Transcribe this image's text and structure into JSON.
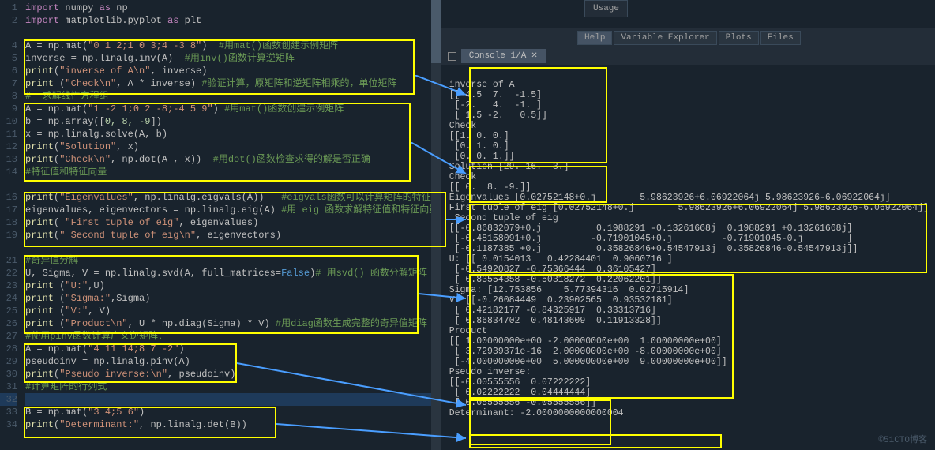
{
  "top": {
    "usage": "Usage"
  },
  "tabs": {
    "help": "Help",
    "varexp": "Variable Explorer",
    "plots": "Plots",
    "files": "Files"
  },
  "console": {
    "tab": "Console 1/A"
  },
  "gutter": [
    "1",
    "2",
    "",
    "4",
    "5",
    "6",
    "7",
    "8",
    "9",
    "10",
    "11",
    "12",
    "13",
    "14",
    "",
    "16",
    "17",
    "18",
    "19",
    "",
    "21",
    "22",
    "23",
    "24",
    "25",
    "26",
    "27",
    "28",
    "29",
    "30",
    "31",
    "32",
    "33",
    "34"
  ],
  "code": {
    "l1a": "import",
    "l1b": " numpy ",
    "l1c": "as",
    "l1d": " np",
    "l2a": "import",
    "l2b": " matplotlib.pyplot ",
    "l2c": "as",
    "l2d": " plt",
    "l4": "A = np.mat(",
    "l4s": "\"0 1 2;1 0 3;4 -3 8\"",
    "l4e": ")  ",
    "l4c": "#用mat()函数创建示例矩阵",
    "l5": "inverse = np.linalg.inv(A)  ",
    "l5c": "#用inv()函数计算逆矩阵",
    "l6a": "print",
    "l6b": "(",
    "l6s": "\"inverse of A\\n\"",
    "l6c": ", inverse)",
    "l7a": "print ",
    "l7b": "(",
    "l7s": "\"Check\\n\"",
    "l7c": ", A * inverse) ",
    "l7d": "#验证计算，原矩阵和逆矩阵相乘的，单位矩阵",
    "l8": "#  求解线性方程组",
    "l9": "A = np.mat(",
    "l9s": "\"1 -2 1;0 2 -8;-4 5 9\"",
    "l9e": ") ",
    "l9c": "#用mat()函数创建示例矩阵",
    "l10": "b = np.array([",
    "l10n": "0, 8, -9",
    "l10e": "])",
    "l11": "x = np.linalg.solve(A, b)",
    "l12a": "print",
    "l12b": "(",
    "l12s": "\"Solution\"",
    "l12c": ", x)",
    "l13a": "print",
    "l13b": "(",
    "l13s": "\"Check\\n\"",
    "l13c": ", np.dot(A , x))  ",
    "l13d": "#用dot()函数检查求得的解是否正确",
    "l14": "#特征值和特征向量",
    "l16a": "print",
    "l16b": "(",
    "l16s": "\"Eigenvalues\"",
    "l16c": ", np.linalg.eigvals(A))   ",
    "l16d": "#eigvals函数可以计算矩阵的特征值",
    "l17": "eigenvalues, eigenvectors = np.linalg.eig(A) ",
    "l17c": "#用 eig 函数求解特征值和特征向量",
    "l18a": "print",
    "l18b": "( ",
    "l18s": "\"First tuple of eig\"",
    "l18c": ", eigenvalues)",
    "l19a": "print",
    "l19b": "(",
    "l19s": "\" Second tuple of eig\\n\"",
    "l19c": ", eigenvectors)",
    "l21": "#奇异值分解",
    "l22": "U, Sigma, V = np.linalg.svd(A, full_matrices=",
    "l22f": "False",
    "l22e": ")",
    "l22c": "# 用svd() 函数分解矩阵",
    "l23a": "print ",
    "l23b": "(",
    "l23s": "\"U:\"",
    "l23c": ",U)",
    "l24a": "print ",
    "l24b": "(",
    "l24s": "\"Sigma:\"",
    "l24c": ",Sigma)",
    "l25a": "print ",
    "l25b": "(",
    "l25s": "\"V:\"",
    "l25c": ", V)",
    "l26a": "print ",
    "l26b": "(",
    "l26s": "\"Product\\n\"",
    "l26c": ", U * np.diag(Sigma) * V) ",
    "l26d": "#用diag函数生成完整的奇异值矩阵",
    "l27": "#使用pinv函数计算广义逆矩阵：",
    "l28": "A = np.mat(",
    "l28s": "\"4 11 14;8 7 -2\"",
    "l28e": ")",
    "l29": "pseudoinv = np.linalg.pinv(A)",
    "l30a": "print",
    "l30b": "(",
    "l30s": "\"Pseudo inverse:\\n\"",
    "l30c": ", pseudoinv)",
    "l31": "#计算矩阵的行列式",
    "l33": "B = np.mat(",
    "l33s": "\"3 4;5 6\"",
    "l33e": ")",
    "l34a": "print",
    "l34b": "(",
    "l34s": "\"Determinant:\"",
    "l34c": ", np.linalg.det(B))"
  },
  "out": {
    "o1": "inverse of A",
    "o2": "[[-4.5  7.  -1.5]",
    "o3": " [-2.   4.  -1. ]",
    "o4": " [ 1.5 -2.   0.5]]",
    "o5": "Check",
    "o6": "[[1. 0. 0.]",
    "o7": " [0. 1. 0.]",
    "o8": " [0. 0. 1.]]",
    "o9": "Solution [29. 16.  3.]",
    "o10": "Check",
    "o11": "[[ 0.  8. -9.]]",
    "o12": "Eigenvalues [0.02752148+0.j        5.98623926+6.06922064j 5.98623926-6.06922064j]",
    "o13": "First tuple of eig [0.02752148+0.j        5.98623926+6.06922064j 5.98623926-6.06922064j]",
    "o14": " Second tuple of eig",
    "o15": "[[-0.86832079+0.j          0.1988291 -0.13261668j  0.1988291 +0.13261668j]",
    "o16": " [-0.48158091+0.j         -0.71901045+0.j         -0.71901045-0.j        ]",
    "o17": " [-0.1187385 +0.j          0.35826846+0.54547913j  0.35826846-0.54547913j]]",
    "o18": "U: [[ 0.0154013   0.42284401  0.9060716 ]",
    "o19": " [-0.54920827 -0.75366444  0.36105427]",
    "o20": " [ 0.83554358 -0.50318272  0.22062201]]",
    "o21": "Sigma: [12.753856    5.77394316  0.02715914]",
    "o22": "V: [[-0.26084449  0.23902565  0.93532181]",
    "o23": " [ 0.42182177 -0.84325917  0.33313716]",
    "o24": " [ 0.86834702  0.48143609  0.11913328]]",
    "o25": "Product",
    "o26": "[[ 1.00000000e+00 -2.00000000e+00  1.00000000e+00]",
    "o27": " [ 3.72939371e-16  2.00000000e+00 -8.00000000e+00]",
    "o28": " [-4.00000000e+00  5.00000000e+00  9.00000000e+00]]",
    "o29": "Pseudo inverse:",
    "o30": "[[-0.00555556  0.07222222]",
    "o31": " [ 0.02222222  0.04444444]",
    "o32": " [ 0.05555556 -0.05555556]]",
    "o33": "Determinant: -2.0000000000000004"
  },
  "watermark": "©51CTO博客"
}
